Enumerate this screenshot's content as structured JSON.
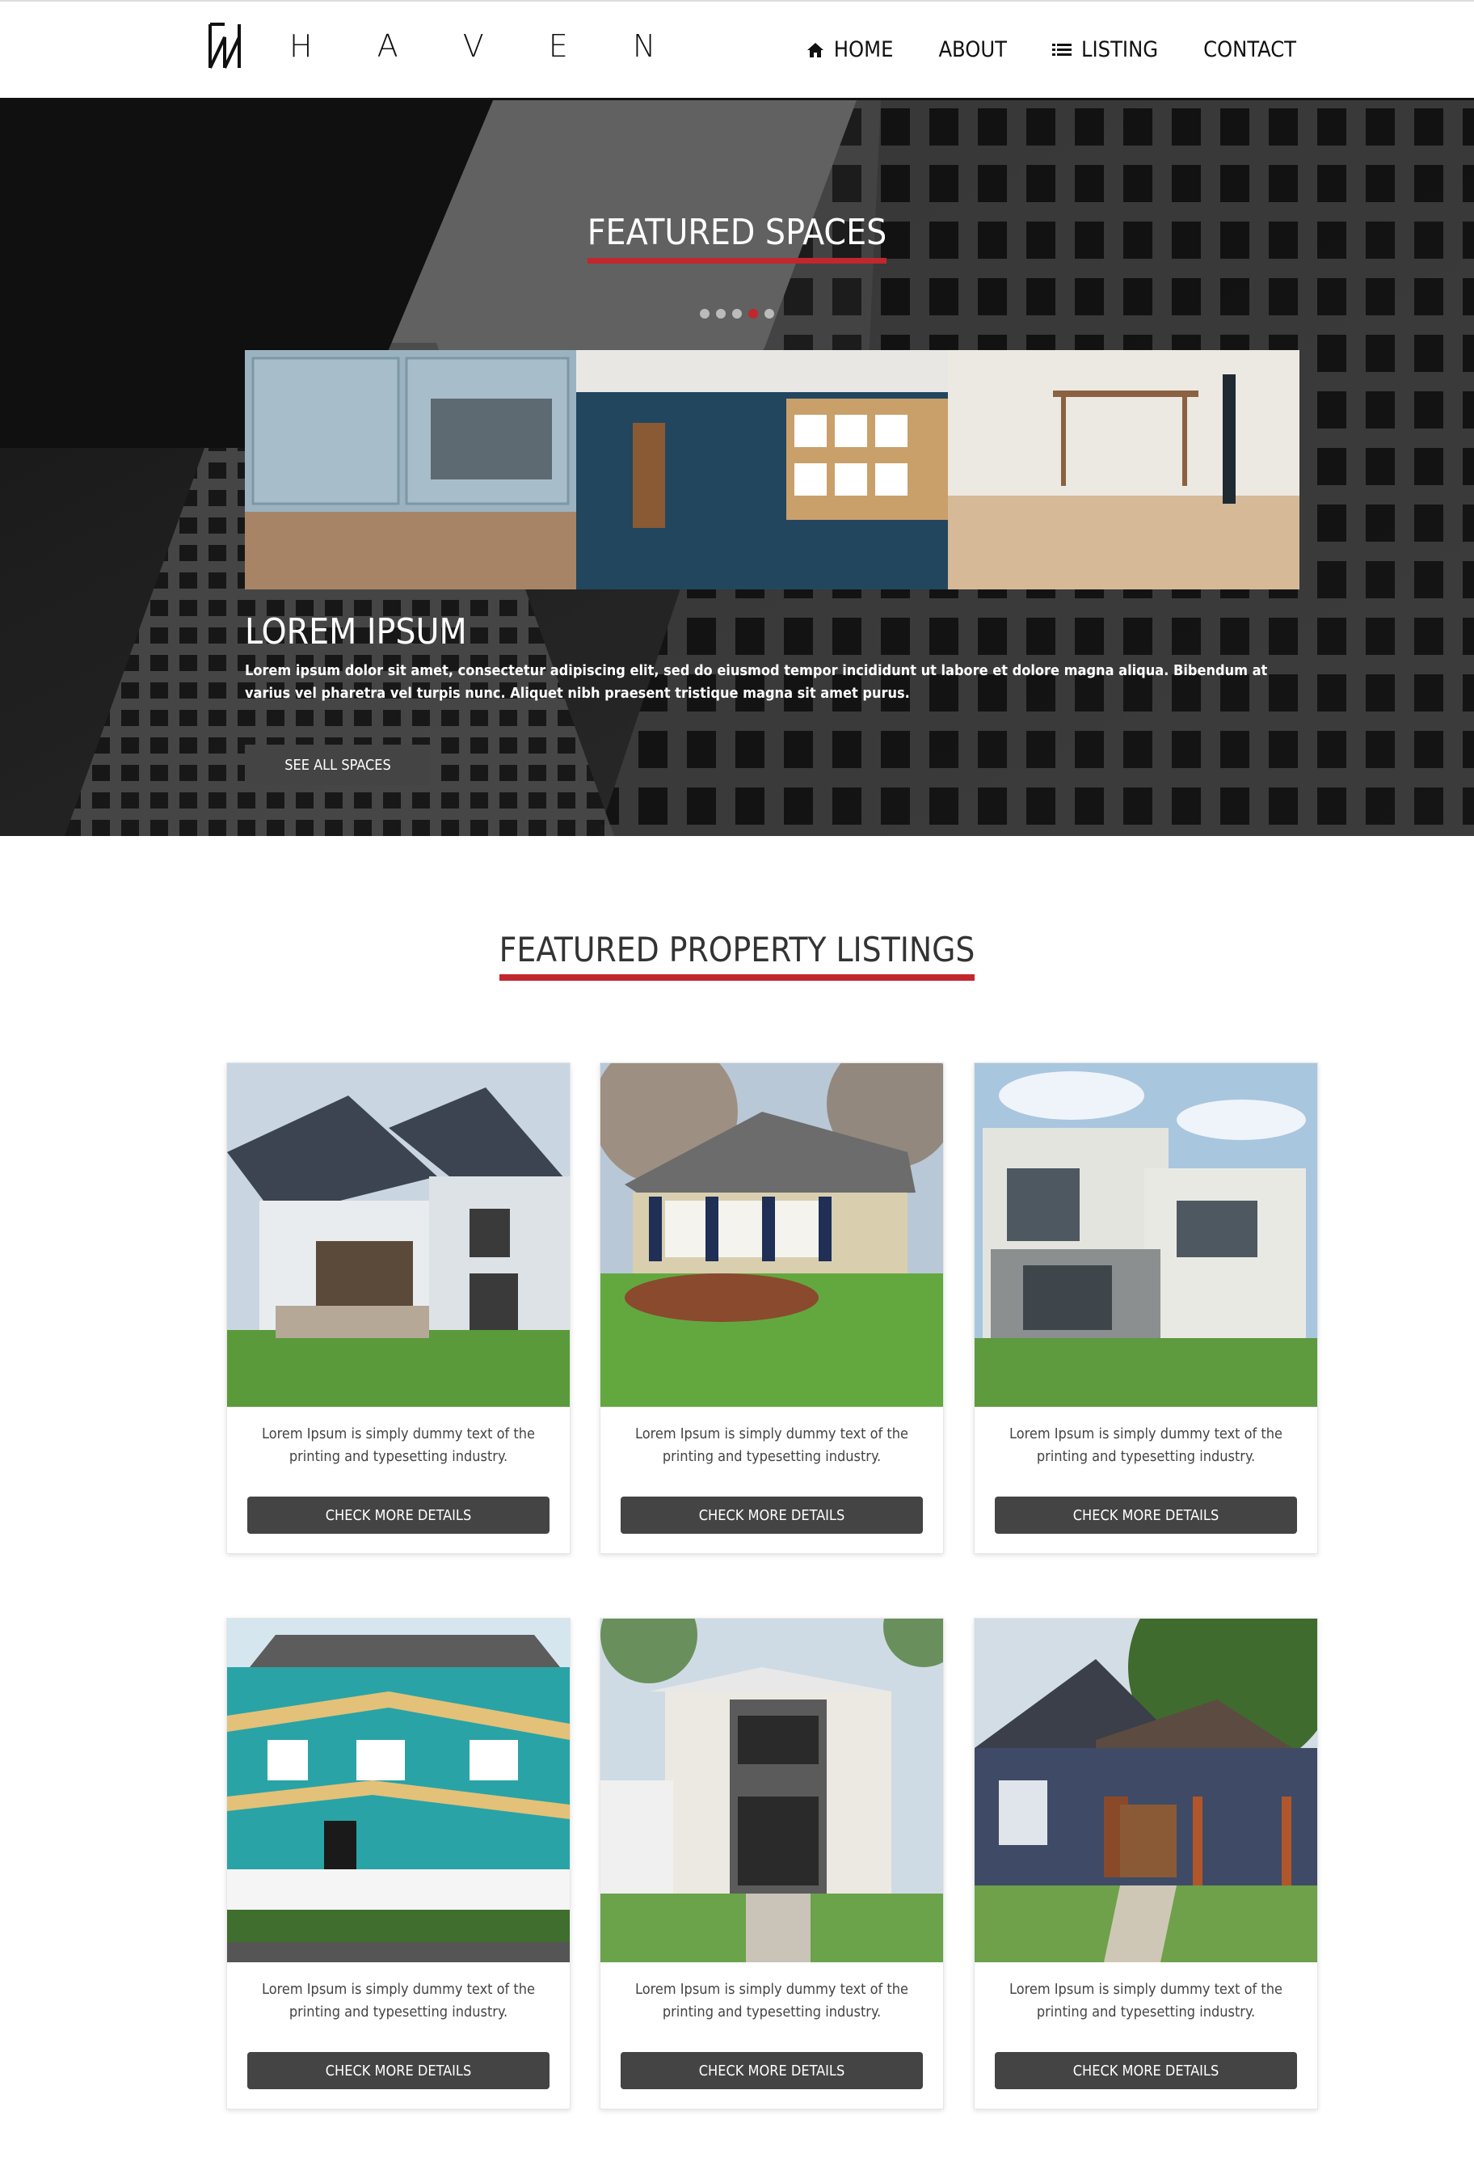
{
  "brand": {
    "name": "H A V E N"
  },
  "nav": [
    {
      "label": "HOME",
      "icon": "home-icon"
    },
    {
      "label": "ABOUT",
      "icon": ""
    },
    {
      "label": "LISTING",
      "icon": "list-icon"
    },
    {
      "label": "CONTACT",
      "icon": ""
    }
  ],
  "hero": {
    "title": "FEATURED SPACES",
    "slide_count": 5,
    "active_slide": 4,
    "slide_heading": "LOREM IPSUM",
    "slide_text": "Lorem ipsum dolor sit amet, consectetur adipiscing elit, sed do eiusmod tempor incididunt ut labore et dolore magna aliqua. Bibendum at varius vel pharetra vel turpis nunc. Aliquet nibh praesent tristique magna sit amet purus.",
    "button_label": "SEE ALL SPACES"
  },
  "listings": {
    "title": "FEATURED PROPERTY LISTINGS",
    "items": [
      {
        "description": "Lorem Ipsum is simply dummy text of the printing and typesetting industry.",
        "button_label": "CHECK MORE DETAILS"
      },
      {
        "description": "Lorem Ipsum is simply dummy text of the printing and typesetting industry.",
        "button_label": "CHECK MORE DETAILS"
      },
      {
        "description": "Lorem Ipsum is simply dummy text of the printing and typesetting industry.",
        "button_label": "CHECK MORE DETAILS"
      },
      {
        "description": "Lorem Ipsum is simply dummy text of the printing and typesetting industry.",
        "button_label": "CHECK MORE DETAILS"
      },
      {
        "description": "Lorem Ipsum is simply dummy text of the printing and typesetting industry.",
        "button_label": "CHECK MORE DETAILS"
      },
      {
        "description": "Lorem Ipsum is simply dummy text of the printing and typesetting industry.",
        "button_label": "CHECK MORE DETAILS"
      }
    ]
  },
  "colors": {
    "accent": "#c1272d",
    "button": "#444444",
    "header_border": "#111111"
  }
}
